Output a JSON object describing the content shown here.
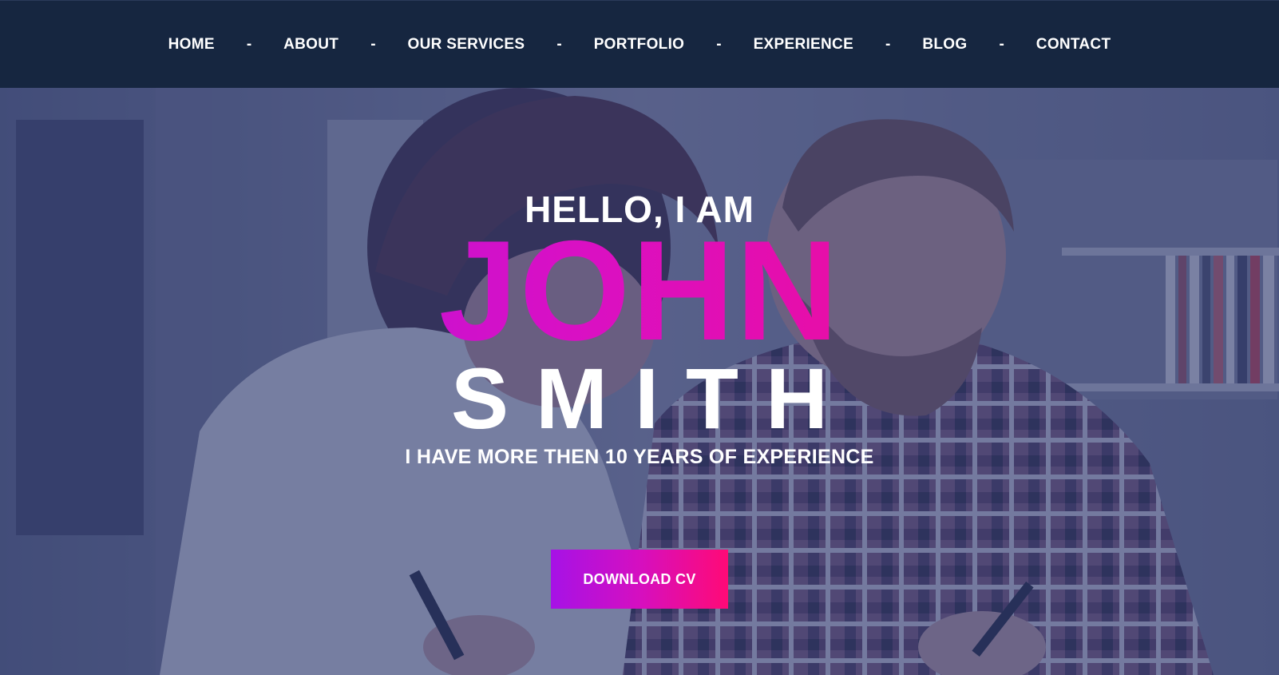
{
  "nav": {
    "items": [
      {
        "label": "HOME"
      },
      {
        "label": "ABOUT"
      },
      {
        "label": "OUR SERVICES"
      },
      {
        "label": "PORTFOLIO"
      },
      {
        "label": "EXPERIENCE"
      },
      {
        "label": "BLOG"
      },
      {
        "label": "CONTACT"
      }
    ],
    "separator": "-"
  },
  "hero": {
    "greeting": "HELLO, I AM",
    "first_name": "JOHN",
    "last_name": "SMITH",
    "tagline": "I HAVE MORE THEN 10 YEARS OF EXPERIENCE",
    "cta_label": "DOWNLOAD CV"
  },
  "colors": {
    "nav_background": "#162640",
    "overlay": "#303a6e",
    "gradient_start": "#a816e8",
    "gradient_end": "#ff0a78",
    "text": "#ffffff"
  }
}
